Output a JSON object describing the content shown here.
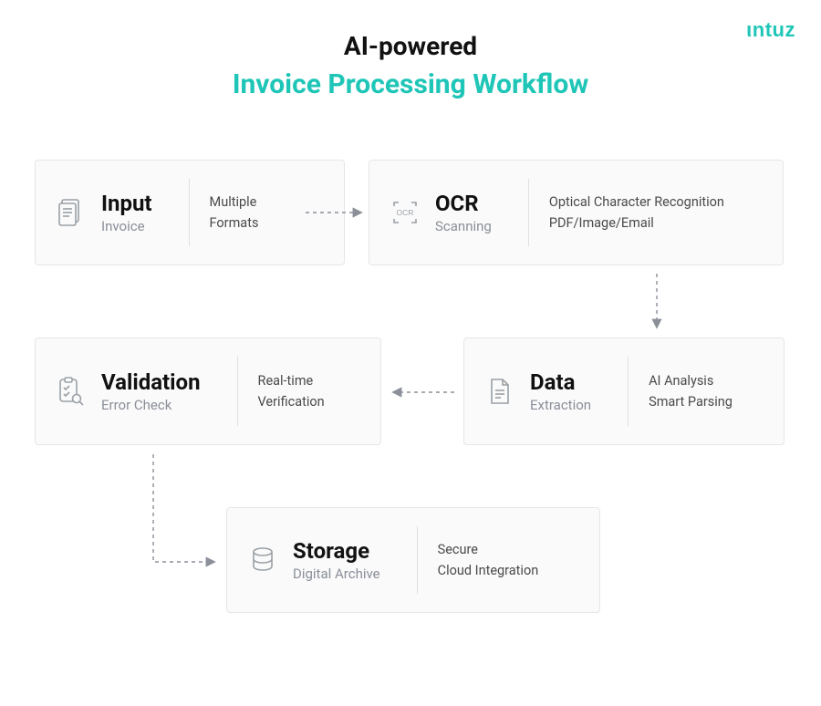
{
  "brand": "ιntuz",
  "heading": {
    "line1": "AI-powered",
    "line2": "Invoice Processing Workflow"
  },
  "cards": {
    "input": {
      "title": "Input",
      "subtitle": "Invoice",
      "detail1": "Multiple",
      "detail2": "Formats"
    },
    "ocr": {
      "title": "OCR",
      "subtitle": "Scanning",
      "detail1": "Optical Character Recognition",
      "detail2": "PDF/Image/Email"
    },
    "data": {
      "title": "Data",
      "subtitle": "Extraction",
      "detail1": "AI Analysis",
      "detail2": "Smart Parsing"
    },
    "validation": {
      "title": "Validation",
      "subtitle": "Error Check",
      "detail1": "Real-time",
      "detail2": "Verification"
    },
    "storage": {
      "title": "Storage",
      "subtitle": "Digital Archive",
      "detail1": "Secure",
      "detail2": "Cloud Integration"
    }
  }
}
